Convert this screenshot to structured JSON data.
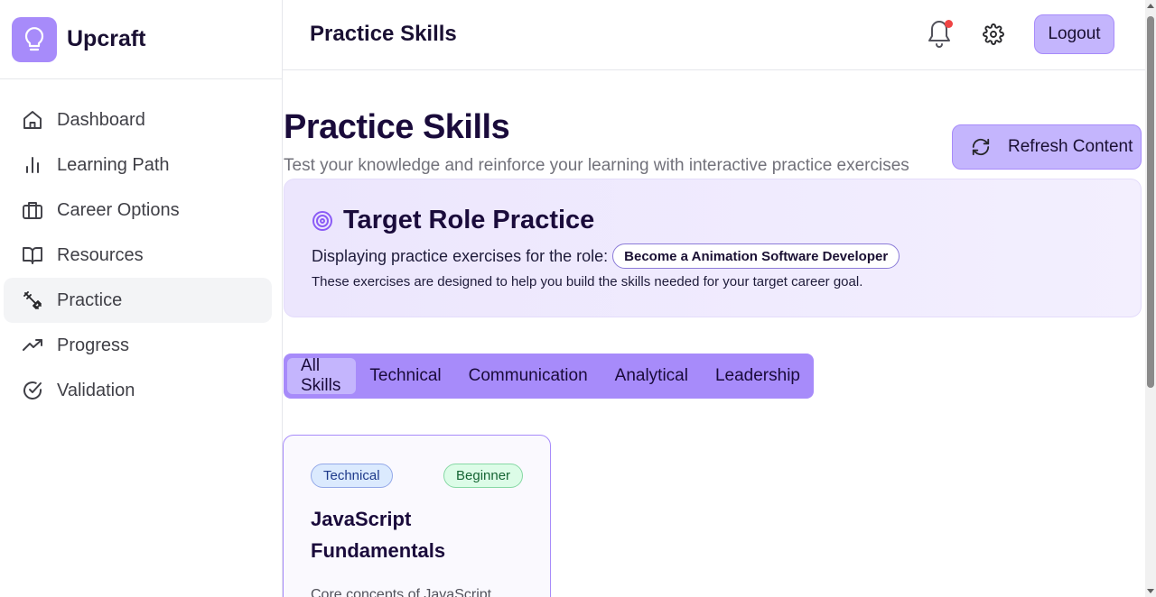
{
  "app": {
    "name": "Upcraft",
    "brand_color": "#a78bfa"
  },
  "sidebar": {
    "items": [
      {
        "label": "Dashboard",
        "icon": "home-icon"
      },
      {
        "label": "Learning Path",
        "icon": "bar-chart-icon"
      },
      {
        "label": "Career Options",
        "icon": "briefcase-icon"
      },
      {
        "label": "Resources",
        "icon": "book-open-icon"
      },
      {
        "label": "Practice",
        "icon": "dumbbell-icon",
        "active": true
      },
      {
        "label": "Progress",
        "icon": "trending-up-icon"
      },
      {
        "label": "Validation",
        "icon": "check-circle-icon"
      }
    ]
  },
  "header": {
    "title": "Practice Skills",
    "notification_unread": true,
    "logout_label": "Logout"
  },
  "main": {
    "title": "Practice Skills",
    "subtitle": "Test your knowledge and reinforce your learning with interactive practice exercises",
    "refresh_label": "Refresh Content",
    "target": {
      "title": "Target Role Practice",
      "role_prefix": "Displaying practice exercises for the role:",
      "role": "Become a Animation Software Developer",
      "description": "These exercises are designed to help you build the skills needed for your target career goal."
    },
    "tabs": [
      {
        "label": "All Skills",
        "active": true
      },
      {
        "label": "Technical"
      },
      {
        "label": "Communication"
      },
      {
        "label": "Analytical"
      },
      {
        "label": "Leadership"
      }
    ],
    "cards": [
      {
        "category": "Technical",
        "level": "Beginner",
        "title": "JavaScript Fundamentals",
        "description": "Core concepts of JavaScript"
      }
    ]
  }
}
